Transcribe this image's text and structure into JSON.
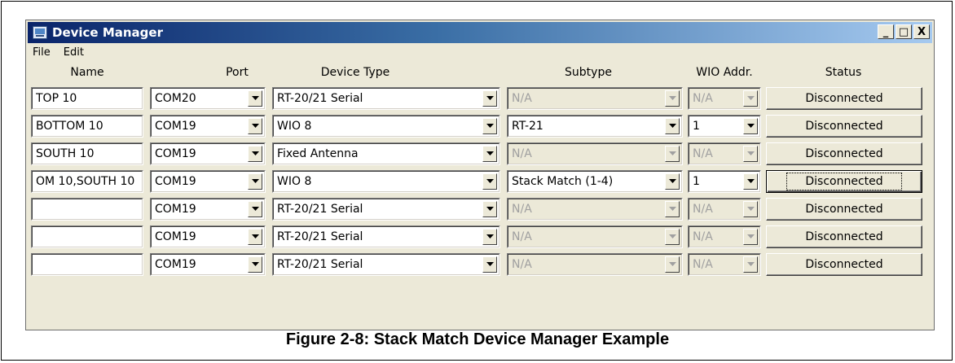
{
  "window": {
    "title": "Device Manager",
    "menu": [
      "File",
      "Edit"
    ],
    "controls": [
      "_",
      "□",
      "X"
    ]
  },
  "columns": {
    "name": "Name",
    "port": "Port",
    "device_type": "Device Type",
    "subtype": "Subtype",
    "wio_addr": "WIO Addr.",
    "status": "Status"
  },
  "rows": [
    {
      "name": "TOP 10",
      "port": "COM20",
      "device_type": "RT-20/21 Serial",
      "subtype": "N/A",
      "subtype_enabled": false,
      "wio": "N/A",
      "wio_enabled": false,
      "status": "Disconnected"
    },
    {
      "name": "BOTTOM 10",
      "port": "COM19",
      "device_type": "WIO 8",
      "subtype": "RT-21",
      "subtype_enabled": true,
      "wio": "1",
      "wio_enabled": true,
      "status": "Disconnected"
    },
    {
      "name": "SOUTH 10",
      "port": "COM19",
      "device_type": "Fixed Antenna",
      "subtype": "N/A",
      "subtype_enabled": false,
      "wio": "N/A",
      "wio_enabled": false,
      "status": "Disconnected"
    },
    {
      "name": "OM 10,SOUTH 10",
      "port": "COM19",
      "device_type": "WIO 8",
      "subtype": "Stack Match (1-4)",
      "subtype_enabled": true,
      "wio": "1",
      "wio_enabled": true,
      "status": "Disconnected",
      "focused": true
    },
    {
      "name": "",
      "port": "COM19",
      "device_type": "RT-20/21 Serial",
      "subtype": "N/A",
      "subtype_enabled": false,
      "wio": "N/A",
      "wio_enabled": false,
      "status": "Disconnected"
    },
    {
      "name": "",
      "port": "COM19",
      "device_type": "RT-20/21 Serial",
      "subtype": "N/A",
      "subtype_enabled": false,
      "wio": "N/A",
      "wio_enabled": false,
      "status": "Disconnected"
    },
    {
      "name": "",
      "port": "COM19",
      "device_type": "RT-20/21 Serial",
      "subtype": "N/A",
      "subtype_enabled": false,
      "wio": "N/A",
      "wio_enabled": false,
      "status": "Disconnected"
    }
  ],
  "caption": "Figure 2-8:  Stack Match Device Manager Example"
}
